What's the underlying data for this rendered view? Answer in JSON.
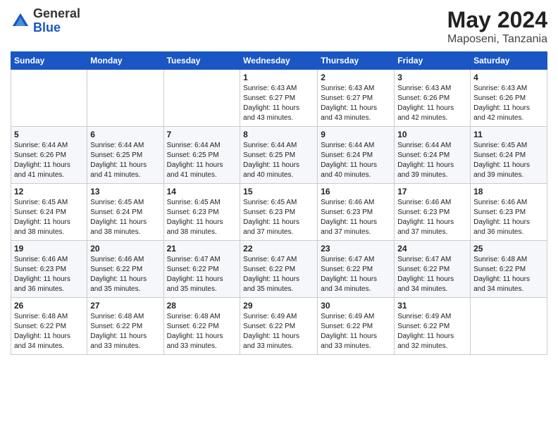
{
  "logo": {
    "general": "General",
    "blue": "Blue"
  },
  "title": {
    "month_year": "May 2024",
    "location": "Maposeni, Tanzania"
  },
  "days_of_week": [
    "Sunday",
    "Monday",
    "Tuesday",
    "Wednesday",
    "Thursday",
    "Friday",
    "Saturday"
  ],
  "weeks": [
    [
      {
        "day": "",
        "info": ""
      },
      {
        "day": "",
        "info": ""
      },
      {
        "day": "",
        "info": ""
      },
      {
        "day": "1",
        "info": "Sunrise: 6:43 AM\nSunset: 6:27 PM\nDaylight: 11 hours\nand 43 minutes."
      },
      {
        "day": "2",
        "info": "Sunrise: 6:43 AM\nSunset: 6:27 PM\nDaylight: 11 hours\nand 43 minutes."
      },
      {
        "day": "3",
        "info": "Sunrise: 6:43 AM\nSunset: 6:26 PM\nDaylight: 11 hours\nand 42 minutes."
      },
      {
        "day": "4",
        "info": "Sunrise: 6:43 AM\nSunset: 6:26 PM\nDaylight: 11 hours\nand 42 minutes."
      }
    ],
    [
      {
        "day": "5",
        "info": "Sunrise: 6:44 AM\nSunset: 6:26 PM\nDaylight: 11 hours\nand 41 minutes."
      },
      {
        "day": "6",
        "info": "Sunrise: 6:44 AM\nSunset: 6:25 PM\nDaylight: 11 hours\nand 41 minutes."
      },
      {
        "day": "7",
        "info": "Sunrise: 6:44 AM\nSunset: 6:25 PM\nDaylight: 11 hours\nand 41 minutes."
      },
      {
        "day": "8",
        "info": "Sunrise: 6:44 AM\nSunset: 6:25 PM\nDaylight: 11 hours\nand 40 minutes."
      },
      {
        "day": "9",
        "info": "Sunrise: 6:44 AM\nSunset: 6:24 PM\nDaylight: 11 hours\nand 40 minutes."
      },
      {
        "day": "10",
        "info": "Sunrise: 6:44 AM\nSunset: 6:24 PM\nDaylight: 11 hours\nand 39 minutes."
      },
      {
        "day": "11",
        "info": "Sunrise: 6:45 AM\nSunset: 6:24 PM\nDaylight: 11 hours\nand 39 minutes."
      }
    ],
    [
      {
        "day": "12",
        "info": "Sunrise: 6:45 AM\nSunset: 6:24 PM\nDaylight: 11 hours\nand 38 minutes."
      },
      {
        "day": "13",
        "info": "Sunrise: 6:45 AM\nSunset: 6:24 PM\nDaylight: 11 hours\nand 38 minutes."
      },
      {
        "day": "14",
        "info": "Sunrise: 6:45 AM\nSunset: 6:23 PM\nDaylight: 11 hours\nand 38 minutes."
      },
      {
        "day": "15",
        "info": "Sunrise: 6:45 AM\nSunset: 6:23 PM\nDaylight: 11 hours\nand 37 minutes."
      },
      {
        "day": "16",
        "info": "Sunrise: 6:46 AM\nSunset: 6:23 PM\nDaylight: 11 hours\nand 37 minutes."
      },
      {
        "day": "17",
        "info": "Sunrise: 6:46 AM\nSunset: 6:23 PM\nDaylight: 11 hours\nand 37 minutes."
      },
      {
        "day": "18",
        "info": "Sunrise: 6:46 AM\nSunset: 6:23 PM\nDaylight: 11 hours\nand 36 minutes."
      }
    ],
    [
      {
        "day": "19",
        "info": "Sunrise: 6:46 AM\nSunset: 6:23 PM\nDaylight: 11 hours\nand 36 minutes."
      },
      {
        "day": "20",
        "info": "Sunrise: 6:46 AM\nSunset: 6:22 PM\nDaylight: 11 hours\nand 35 minutes."
      },
      {
        "day": "21",
        "info": "Sunrise: 6:47 AM\nSunset: 6:22 PM\nDaylight: 11 hours\nand 35 minutes."
      },
      {
        "day": "22",
        "info": "Sunrise: 6:47 AM\nSunset: 6:22 PM\nDaylight: 11 hours\nand 35 minutes."
      },
      {
        "day": "23",
        "info": "Sunrise: 6:47 AM\nSunset: 6:22 PM\nDaylight: 11 hours\nand 34 minutes."
      },
      {
        "day": "24",
        "info": "Sunrise: 6:47 AM\nSunset: 6:22 PM\nDaylight: 11 hours\nand 34 minutes."
      },
      {
        "day": "25",
        "info": "Sunrise: 6:48 AM\nSunset: 6:22 PM\nDaylight: 11 hours\nand 34 minutes."
      }
    ],
    [
      {
        "day": "26",
        "info": "Sunrise: 6:48 AM\nSunset: 6:22 PM\nDaylight: 11 hours\nand 34 minutes."
      },
      {
        "day": "27",
        "info": "Sunrise: 6:48 AM\nSunset: 6:22 PM\nDaylight: 11 hours\nand 33 minutes."
      },
      {
        "day": "28",
        "info": "Sunrise: 6:48 AM\nSunset: 6:22 PM\nDaylight: 11 hours\nand 33 minutes."
      },
      {
        "day": "29",
        "info": "Sunrise: 6:49 AM\nSunset: 6:22 PM\nDaylight: 11 hours\nand 33 minutes."
      },
      {
        "day": "30",
        "info": "Sunrise: 6:49 AM\nSunset: 6:22 PM\nDaylight: 11 hours\nand 33 minutes."
      },
      {
        "day": "31",
        "info": "Sunrise: 6:49 AM\nSunset: 6:22 PM\nDaylight: 11 hours\nand 32 minutes."
      },
      {
        "day": "",
        "info": ""
      }
    ]
  ]
}
